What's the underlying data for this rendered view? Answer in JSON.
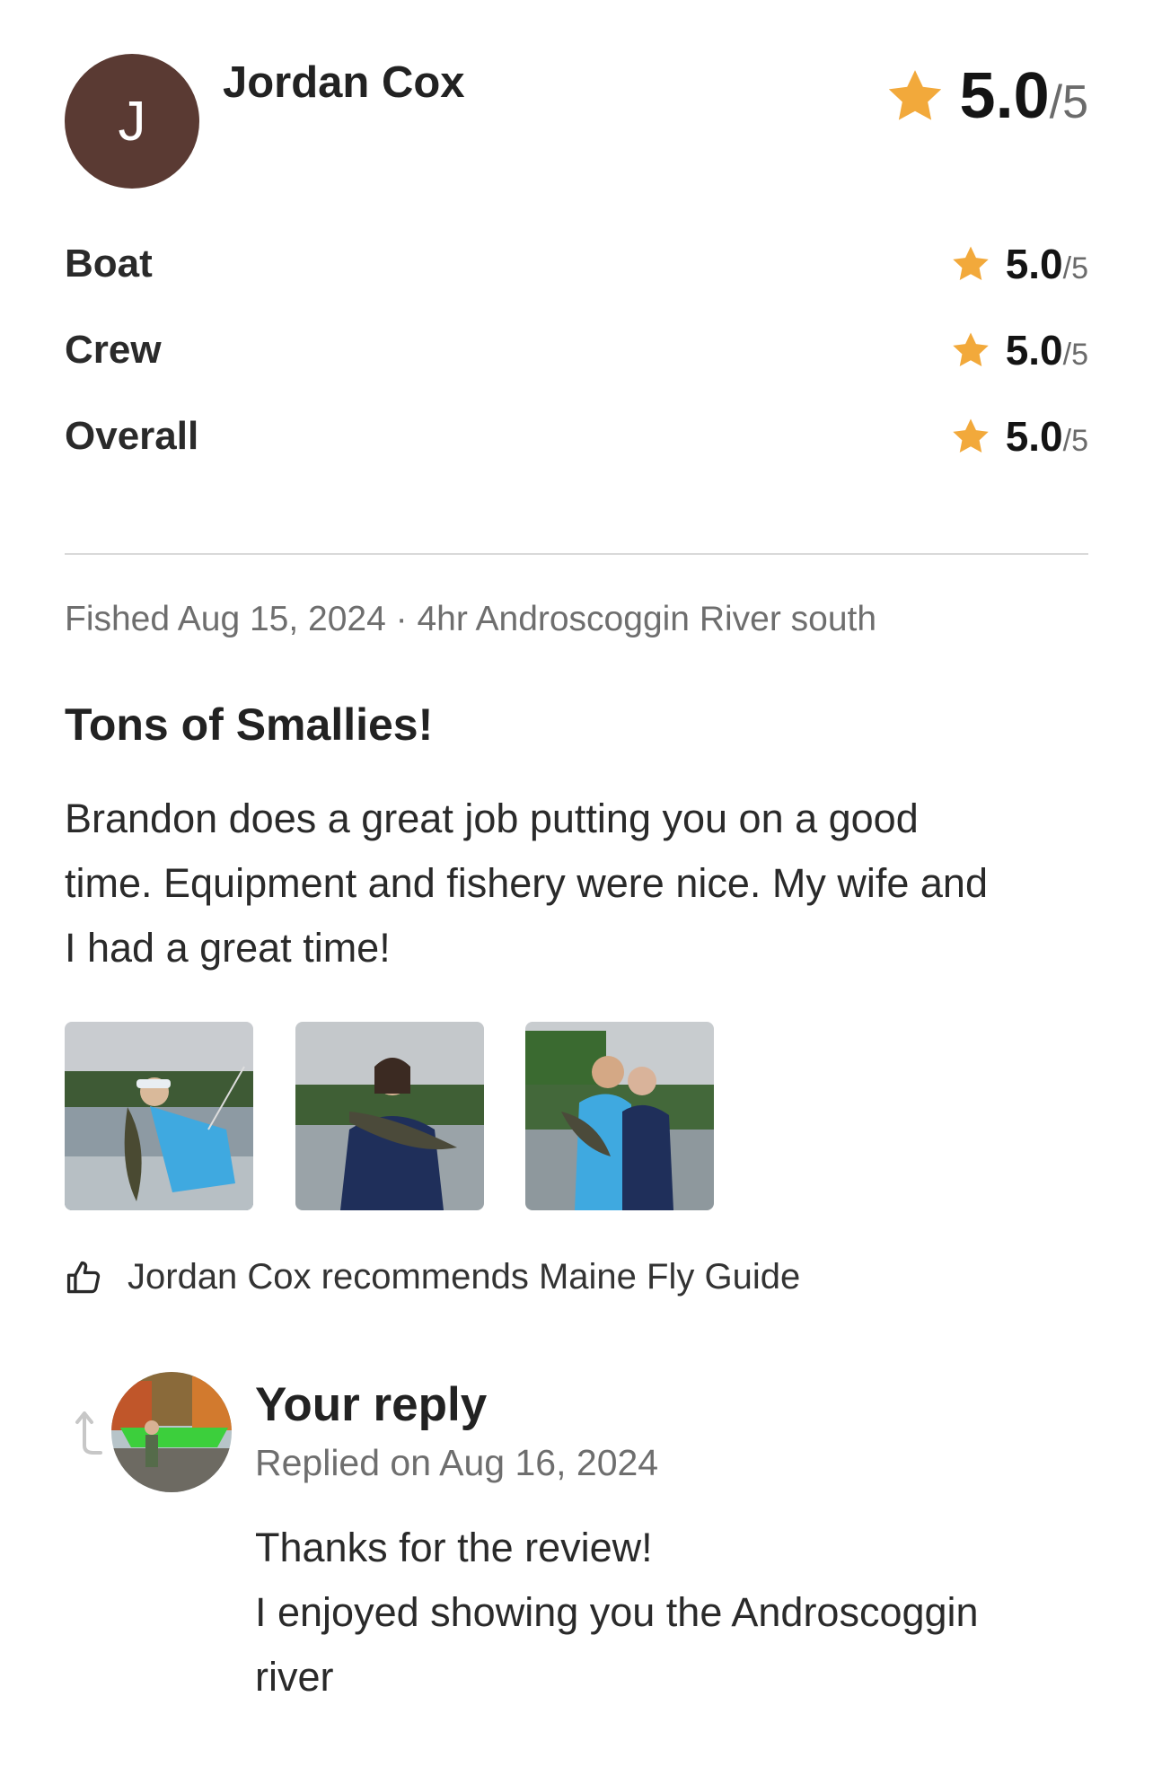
{
  "reviewer": {
    "initial": "J",
    "name": "Jordan Cox",
    "avatar_color": "#5a3a33"
  },
  "overall_rating": {
    "score": "5.0",
    "out_of": "/5",
    "value": 5.0,
    "max": 5
  },
  "ratings": [
    {
      "label": "Boat",
      "score": "5.0",
      "out_of": "/5"
    },
    {
      "label": "Crew",
      "score": "5.0",
      "out_of": "/5"
    },
    {
      "label": "Overall",
      "score": "5.0",
      "out_of": "/5"
    }
  ],
  "trip_meta": "Fished Aug 15, 2024 · 4hr Androscoggin River south",
  "review": {
    "title": "Tons of Smallies!",
    "body_lines": [
      "Brandon does a great job putting you on a good",
      "time. Equipment and fishery were nice. My wife and",
      "I had a great time!"
    ]
  },
  "photos": [
    "photo-man-with-bass",
    "photo-woman-with-bass",
    "photo-couple-with-bass"
  ],
  "recommendation": "Jordan Cox recommends Maine Fly Guide",
  "reply": {
    "title": "Your reply",
    "date": "Replied on Aug 16, 2024",
    "body_lines": [
      "Thanks for the review!",
      "I enjoyed showing you the Androscoggin",
      "river"
    ]
  },
  "colors": {
    "star": "#f2a93b",
    "text_muted": "#6e6e6e",
    "divider": "#d9d9d9"
  },
  "icons": [
    "star-icon",
    "thumbs-up-icon",
    "reply-arrow-icon"
  ]
}
